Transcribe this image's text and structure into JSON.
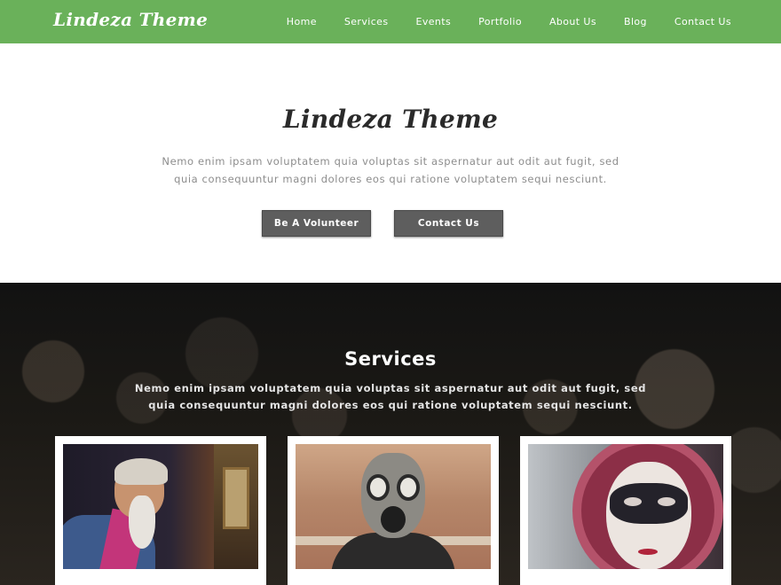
{
  "header": {
    "brand": "Lindeza Theme",
    "nav": [
      "Home",
      "Services",
      "Events",
      "Portfolio",
      "About Us",
      "Blog",
      "Contact Us"
    ],
    "bg_color": "#6ab15a"
  },
  "hero": {
    "title": "Lindeza Theme",
    "text": "Nemo enim ipsam voluptatem quia voluptas sit aspernatur aut odit aut fugit, sed quia consequuntur magni dolores eos qui ratione voluptatem sequi nesciunt.",
    "buttons": [
      "Be A Volunteer",
      "Contact Us"
    ]
  },
  "services": {
    "title": "Services",
    "text": "Nemo enim ipsam voluptatem quia voluptas sit aspernatur aut odit aut fugit, sed quia consequuntur magni dolores eos qui ratione voluptatem sequi nesciunt.",
    "cards": [
      {
        "image": "old-man-photo"
      },
      {
        "image": "gas-mask-photo"
      },
      {
        "image": "venetian-mask-photo"
      }
    ]
  }
}
